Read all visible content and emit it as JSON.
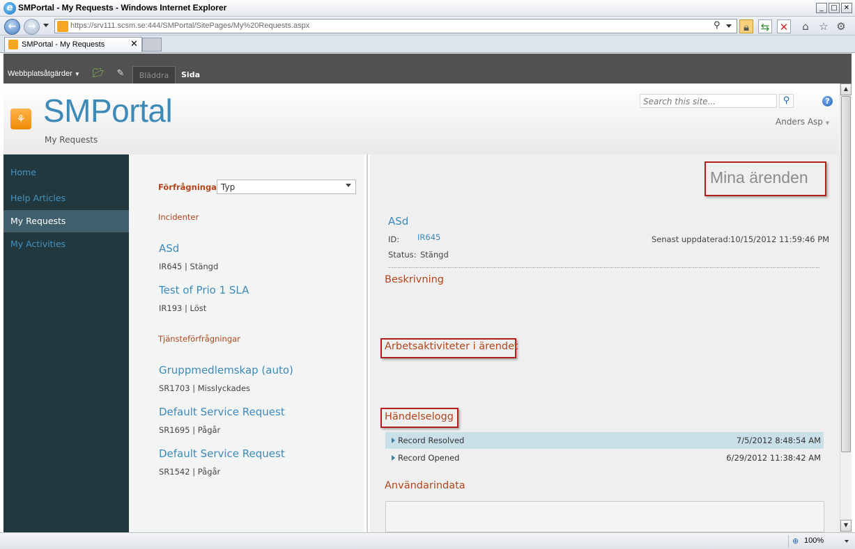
{
  "window": {
    "title": "SMPortal - My Requests - Windows Internet Explorer",
    "url": "https://srv111.scsm.se:444/SMPortal/SitePages/My%20Requests.aspx"
  },
  "browser_tab": {
    "label": "SMPortal - My Requests"
  },
  "ribbon": {
    "site_actions": "Webbplatsåtgärder",
    "tabs": [
      "Bläddra",
      "Sida"
    ]
  },
  "header": {
    "site_title": "SMPortal",
    "breadcrumb": "My Requests",
    "search_placeholder": "Search this site...",
    "user": "Anders Asp"
  },
  "nav": {
    "items": [
      {
        "label": "Home"
      },
      {
        "label": "Help Articles"
      },
      {
        "label": "My Requests",
        "selected": true
      },
      {
        "label": "My Activities"
      }
    ]
  },
  "requests": {
    "filter_label": "Förfrågningar",
    "filter_value": "Typ",
    "incidents_heading": "Incidenter",
    "incidents": [
      {
        "title": "ASd",
        "meta": "IR645 | Stängd"
      },
      {
        "title": "Test of Prio 1 SLA",
        "meta": "IR193 | Löst"
      }
    ],
    "service_heading": "Tjänsteförfrågningar",
    "service_requests": [
      {
        "title": "Gruppmedlemskap (auto)",
        "meta": "SR1703 | Misslyckades"
      },
      {
        "title": "Default Service Request",
        "meta": "SR1695 | Pågår"
      },
      {
        "title": "Default Service Request",
        "meta": "SR1542 | Pågår"
      }
    ]
  },
  "detail": {
    "heading": "Mina ärenden",
    "name": "ASd",
    "id_label": "ID:",
    "id_value": "IR645",
    "status_label": "Status:",
    "status_value": "Stängd",
    "updated_label": "Senast uppdaterad:",
    "updated_value": "10/15/2012 11:59:46 PM",
    "description_heading": "Beskrivning",
    "activities_heading": "Arbetsaktiviteter i ärendet",
    "log_heading": "Händelselogg",
    "log": [
      {
        "label": "Record Resolved",
        "time": "7/5/2012 8:48:54 AM"
      },
      {
        "label": "Record Opened",
        "time": "6/29/2012 11:38:42 AM"
      }
    ],
    "user_input_heading": "Användarindata"
  },
  "statusbar": {
    "zoom": "100%"
  },
  "colors": {
    "link": "#3d8ab9",
    "heading": "#b2451b",
    "nav_bg": "#22383f",
    "highlight_box": "#b11e1e"
  }
}
